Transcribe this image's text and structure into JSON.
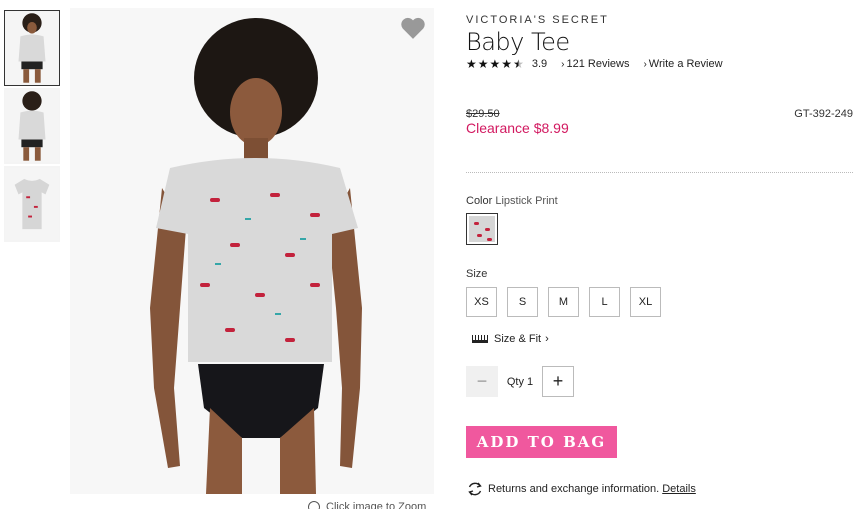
{
  "product": {
    "brand": "VICTORIA'S SECRET",
    "name": "Baby Tee",
    "rating": "3.9",
    "rating_value": 3.9,
    "reviews_link": "121 Reviews",
    "write_review_link": "Write a Review",
    "original_price": "$29.50",
    "sale_price": "Clearance $8.99",
    "sku": "GT-392-249"
  },
  "color": {
    "label": "Color",
    "selected": "Lipstick Print"
  },
  "size": {
    "label": "Size",
    "options": [
      "XS",
      "S",
      "M",
      "L",
      "XL"
    ],
    "size_fit_link": "Size & Fit"
  },
  "quantity": {
    "label": "Qty 1",
    "minus": "−",
    "plus": "+"
  },
  "cta": {
    "add_to_bag": "ADD TO BAG"
  },
  "returns": {
    "text": "Returns and exchange information.",
    "details_link": "Details"
  },
  "zoom_hint": "Click image to Zoom",
  "icons": {
    "heart": "heart-icon",
    "star": "star-icon",
    "ruler": "ruler-icon",
    "returns": "refresh-icon"
  },
  "colors": {
    "sale": "#d21960",
    "cta": "#f0589e",
    "heart": "#999999"
  }
}
